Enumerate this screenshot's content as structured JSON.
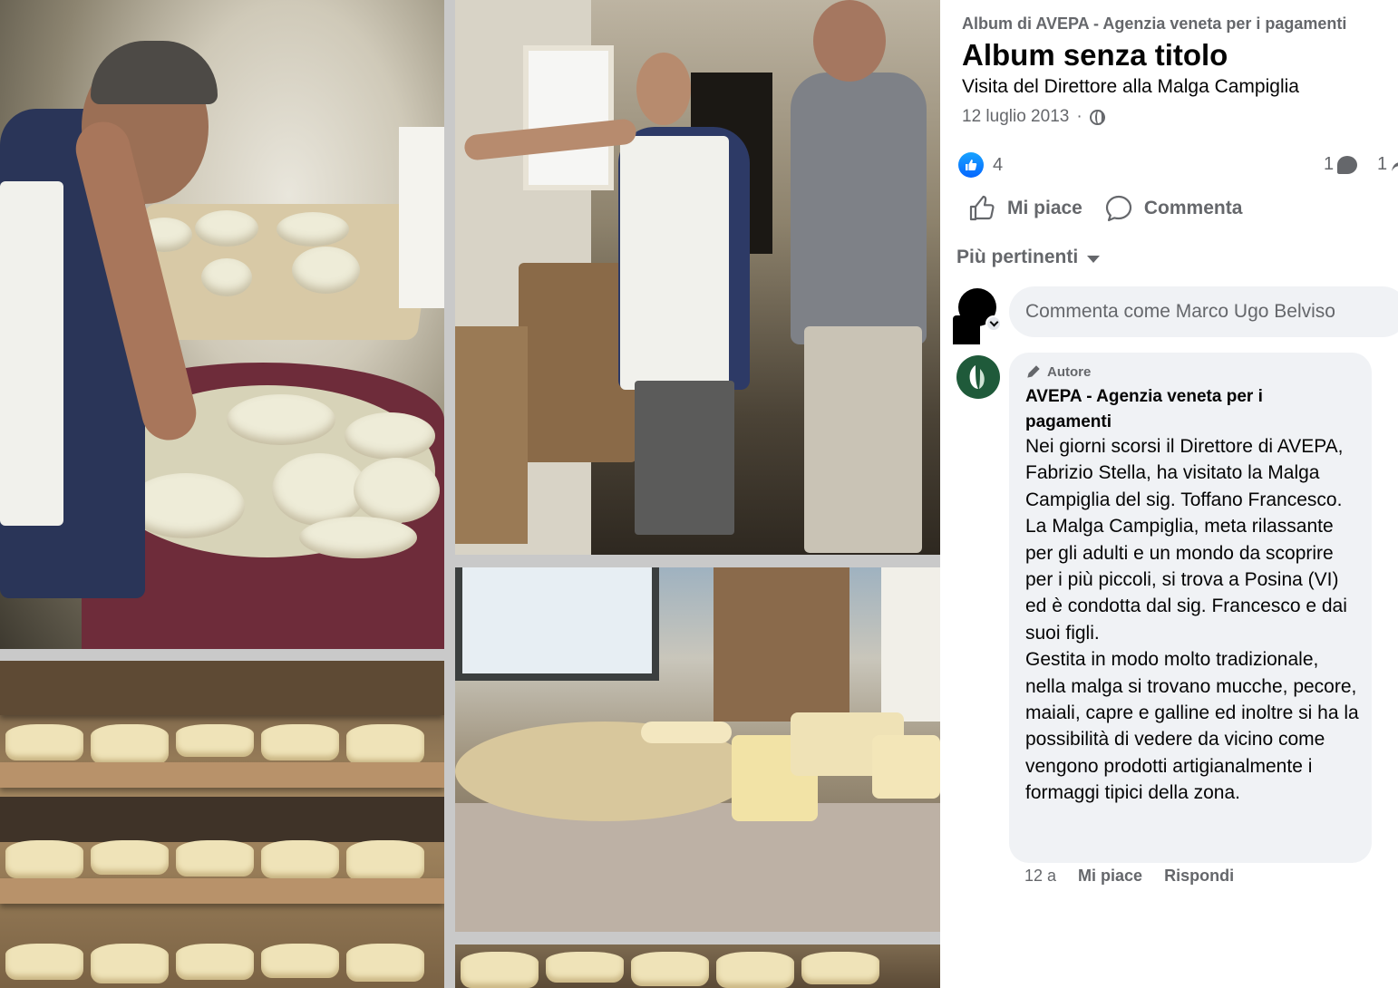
{
  "album": {
    "owner_line": "Album di AVEPA - Agenzia veneta per i pagamenti",
    "title": "Album senza titolo",
    "description": "Visita del Direttore alla Malga Campiglia",
    "date": "12 luglio 2013",
    "privacy_icon": "globe-icon"
  },
  "stats": {
    "reaction_count": "4",
    "comment_count": "1",
    "share_count": "1"
  },
  "actions": {
    "like_label": "Mi piace",
    "comment_label": "Commenta"
  },
  "sort": {
    "label": "Più pertinenti"
  },
  "composer": {
    "placeholder": "Commenta come Marco Ugo Belviso"
  },
  "comment": {
    "badge": "Autore",
    "author": "AVEPA - Agenzia veneta per i pagamenti",
    "text": "Nei giorni scorsi il Direttore di AVEPA, Fabrizio Stella, ha visitato la Malga Campiglia del sig. Toffano Francesco.\nLa Malga Campiglia, meta rilassante per gli adulti e un mondo da scoprire per i più piccoli, si trova a Posina (VI) ed è condotta dal sig. Francesco e dai suoi figli.\nGestita in modo molto tradizionale, nella malga si trovano mucche, pecore, maiali, capre e galline ed inoltre si ha la possibilità di vedere da vicino come vengono prodotti artigianalmente i formaggi tipici della zona.",
    "time": "12 a",
    "like_label": "Mi piace",
    "reply_label": "Rispondi"
  },
  "colors": {
    "primary_text": "#050505",
    "secondary_text": "#65676b",
    "bubble_bg": "#f0f2f5",
    "like_blue": "#0866ff"
  }
}
